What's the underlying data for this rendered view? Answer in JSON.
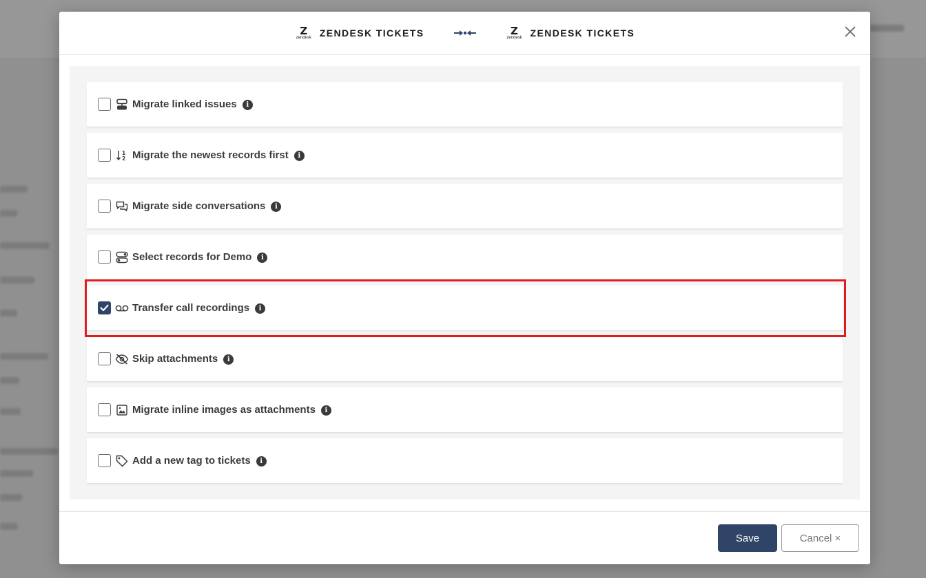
{
  "header": {
    "source_brand": "ZENDESK TICKETS",
    "target_brand": "ZENDESK TICKETS",
    "logo_subtext": "zendesk"
  },
  "options": [
    {
      "label": "Migrate linked issues",
      "checked": false,
      "icon": "linked-issues-icon"
    },
    {
      "label": "Migrate the newest records first",
      "checked": false,
      "icon": "sort-numeric-icon"
    },
    {
      "label": "Migrate side conversations",
      "checked": false,
      "icon": "chat-bubbles-icon"
    },
    {
      "label": "Select records for Demo",
      "checked": false,
      "icon": "toggles-icon"
    },
    {
      "label": "Transfer call recordings",
      "checked": true,
      "icon": "voicemail-icon"
    },
    {
      "label": "Skip attachments",
      "checked": false,
      "icon": "eye-slash-icon"
    },
    {
      "label": "Migrate inline images as attachments",
      "checked": false,
      "icon": "image-icon"
    },
    {
      "label": "Add a new tag to tickets",
      "checked": false,
      "icon": "tag-icon"
    }
  ],
  "info_glyph": "i",
  "footer": {
    "save_label": "Save",
    "cancel_label": "Cancel ×"
  },
  "colors": {
    "primary": "#2f4467",
    "highlight": "#e01b1b"
  }
}
